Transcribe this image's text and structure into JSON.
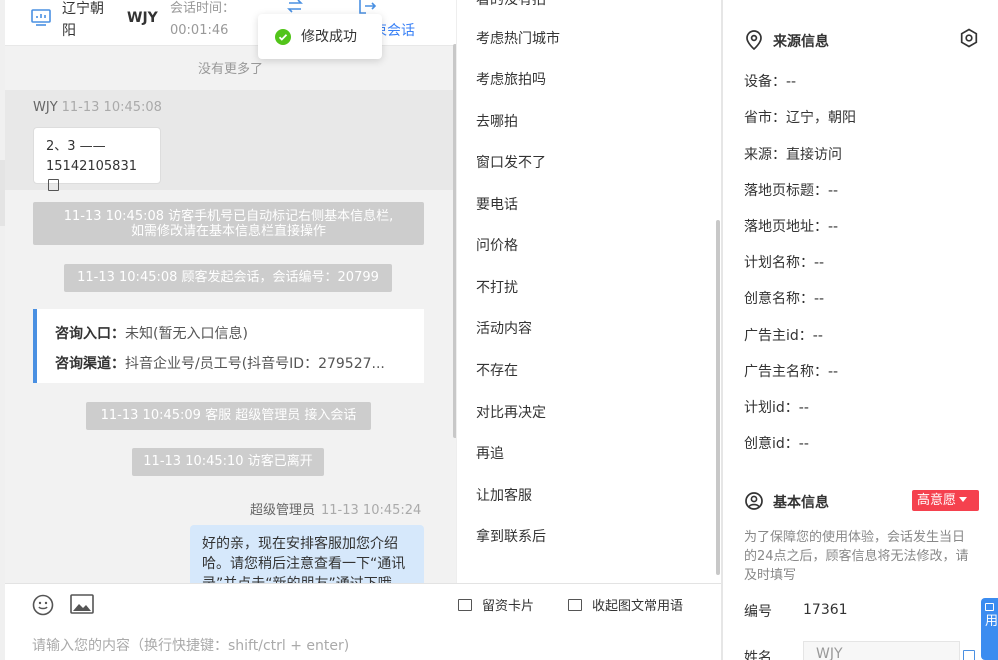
{
  "header": {
    "location": "辽宁朝阳",
    "visitor_name": "WJY",
    "session_time_label": "会话时间：",
    "session_time": "00:01:46",
    "end_session_label": "束会话"
  },
  "toast": {
    "message": "修改成功"
  },
  "chat": {
    "no_more": "没有更多了",
    "visitor_sender": "WJY",
    "visitor_time": "11-13 10:45:08",
    "visitor_msg_line1": "2、3 ——",
    "visitor_msg_line2": "15142105831",
    "sys1_line1": "11-13 10:45:08 访客手机号已自动标记右侧基本信息栏,",
    "sys1_line2": "如需修改请在基本信息栏直接操作",
    "sys2": "11-13 10:45:08 顾客发起会话，会话编号：20799",
    "entry_label": "咨询入口：",
    "entry_value": "未知(暂无入口信息)",
    "channel_label": "咨询渠道：",
    "channel_value": "抖音企业号/员工号(抖音号ID：279527...",
    "sys3": "11-13 10:45:09 客服 超级管理员 接入会话",
    "sys4": "11-13 10:45:10 访客已离开",
    "agent_name": "超级管理员",
    "agent_time": "11-13 10:45:24",
    "agent_msg": "好的亲，现在安排客服加您介绍哈。请您稍后注意查看一下“通讯录”并点击“新的朋友”通过下哦"
  },
  "input": {
    "card_label": "留资卡片",
    "quick_label": "收起图文常用语",
    "placeholder": "请输入您的内容（换行快捷键：shift/ctrl + enter)"
  },
  "phrases": {
    "items": [
      "看的没有拍",
      "考虑热门城市",
      "考虑旅拍吗",
      "去哪拍",
      "窗口发不了",
      "要电话",
      "问价格",
      "不打扰",
      "活动内容",
      "不存在",
      "对比再决定",
      "再追",
      "让加客服",
      "拿到联系后"
    ]
  },
  "source": {
    "title": "来源信息",
    "fields": [
      {
        "label": "设备：",
        "value": "--"
      },
      {
        "label": "省市：",
        "value": "辽宁，朝阳"
      },
      {
        "label": "来源：",
        "value": "直接访问"
      },
      {
        "label": "落地页标题：",
        "value": "--"
      },
      {
        "label": "落地页地址：",
        "value": "--"
      },
      {
        "label": "计划名称：",
        "value": "--"
      },
      {
        "label": "创意名称：",
        "value": "--"
      },
      {
        "label": "广告主id：",
        "value": "--"
      },
      {
        "label": "广告主名称：",
        "value": "--"
      },
      {
        "label": "计划id：",
        "value": "--"
      },
      {
        "label": "创意id：",
        "value": "--"
      }
    ]
  },
  "basic": {
    "title": "基本信息",
    "intent_badge": "高意愿",
    "notice": "为了保障您的使用体验，会话发生当日的24点之后，顾客信息将无法修改，请及时填写",
    "id_label": "编号",
    "id_value": "17361",
    "name_label": "姓名",
    "name_value": "WJY"
  },
  "side_float": {
    "label": "用"
  },
  "colors": {
    "accent": "#3b82f6",
    "success": "#52c41a",
    "badge_red": "#f5414e",
    "agent_bubble": "#d6e8fb",
    "system_msg": "#cdcdcd"
  }
}
